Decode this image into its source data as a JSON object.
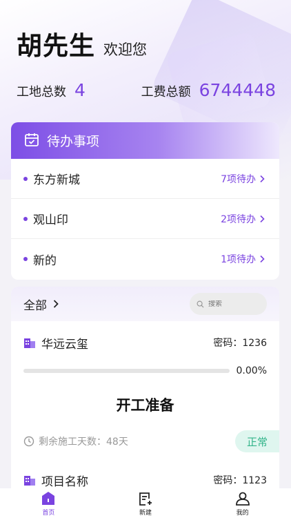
{
  "header": {
    "name": "胡先生",
    "welcome": "欢迎您"
  },
  "stats": {
    "sites_label": "工地总数",
    "sites_value": "4",
    "wage_label": "工费总额",
    "wage_value": "6744448"
  },
  "todo": {
    "title": "待办事项",
    "items": [
      {
        "name": "东方新城",
        "count": "7项待办"
      },
      {
        "name": "观山印",
        "count": "2项待办"
      },
      {
        "name": "新的",
        "count": "1项待办"
      }
    ]
  },
  "projects": {
    "filter_label": "全部",
    "search_placeholder": "搜索",
    "items": [
      {
        "name": "华远云玺",
        "password": "密码：1236",
        "progress_text": "0.00%",
        "progress": 0,
        "phase": "开工准备",
        "remaining_days": "剩余施工天数：48天",
        "status": "正常"
      },
      {
        "name": "项目名称",
        "password": "密码：1123"
      }
    ]
  },
  "tabbar": {
    "items": [
      {
        "label": "首页",
        "icon": "home-icon"
      },
      {
        "label": "新建",
        "icon": "new-doc-icon"
      },
      {
        "label": "我的",
        "icon": "user-icon"
      }
    ]
  },
  "colors": {
    "accent": "#7a43e0",
    "status_ok_bg": "#dff6ef",
    "status_ok_text": "#33b48a"
  }
}
